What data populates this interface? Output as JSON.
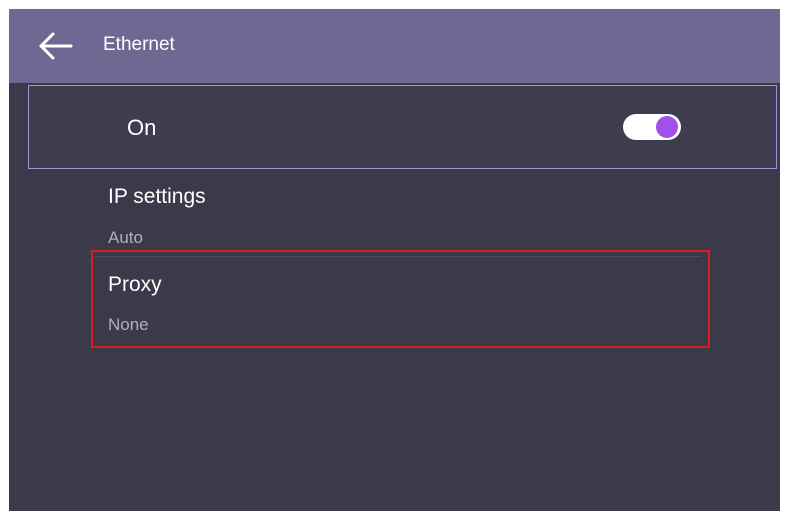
{
  "header": {
    "title": "Ethernet",
    "back_icon": "arrow-left-icon"
  },
  "ethernet_toggle": {
    "label": "On",
    "state": "on",
    "accent_color": "#a150e8"
  },
  "settings": [
    {
      "title": "IP settings",
      "value": "Auto"
    },
    {
      "title": "Proxy",
      "value": "None"
    }
  ],
  "annotation": {
    "highlight_color": "#e0181f"
  },
  "colors": {
    "header_bg": "#6e6892",
    "screen_bg": "#3b3a4b",
    "selection_border": "#a891d8"
  }
}
